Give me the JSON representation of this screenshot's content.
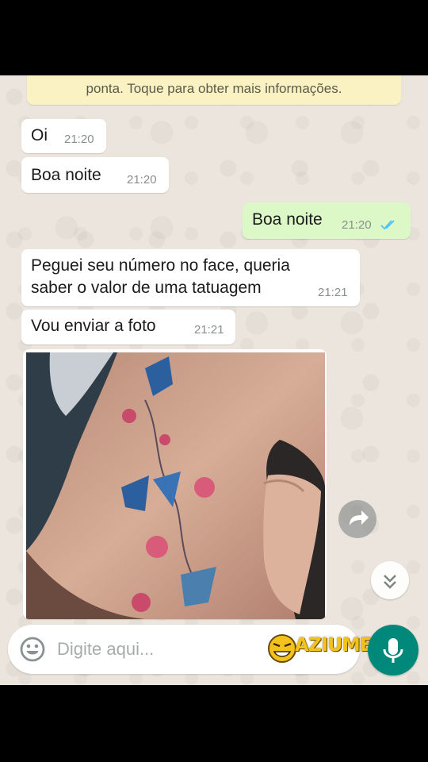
{
  "notice": {
    "text_visible": "ponta. Toque para obter mais informações."
  },
  "messages": [
    {
      "direction": "in",
      "text": "Oi",
      "time": "21:20"
    },
    {
      "direction": "in",
      "text": "Boa noite",
      "time": "21:20"
    },
    {
      "direction": "out",
      "text": "Boa noite",
      "time": "21:20",
      "status": "read-checkmarks-icon"
    },
    {
      "direction": "in",
      "lines": [
        "Peguei seu número  no face,  queria",
        "saber o valor de uma tatuagem"
      ],
      "time": "21:21"
    },
    {
      "direction": "in",
      "text": "Vou enviar  a foto",
      "time": "21:21"
    },
    {
      "direction": "in",
      "type": "image",
      "content": "tattoo-photo"
    }
  ],
  "composer": {
    "placeholder": "Digite aqui...",
    "watermark": "AZIUME"
  },
  "colors": {
    "chat_background": "#ece5dd",
    "outgoing_bubble": "#dcf8c6",
    "incoming_bubble": "#ffffff",
    "notice_background": "#fbf2c4",
    "mic_button": "#00897b",
    "read_ticks": "#4fc3f7"
  }
}
